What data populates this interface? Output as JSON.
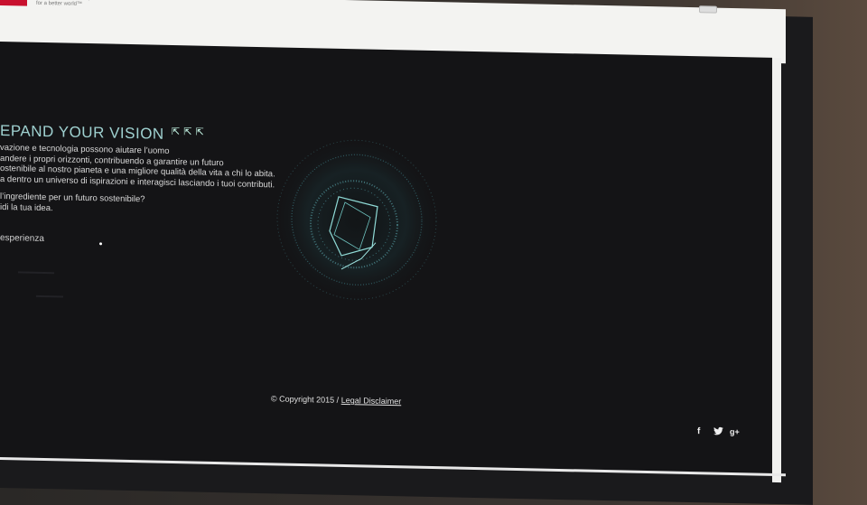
{
  "header": {
    "tagline": "Power and productivity\nfor a better world™"
  },
  "hero": {
    "title": "EPAND YOUR VISION",
    "paragraph1": "vazione e tecnologia possono aiutare l’uomo\nandere i propri orizzonti, contribuendo a garantire un futuro\nostenibile al nostro pianeta e una migliore qualità della vita a chi lo abita.\na dentro un universo di ispirazioni e interagisci lasciando i tuoi contributi.",
    "paragraph2": "l’ingrediente per un futuro sostenibile?\nidi la tua idea.",
    "experience_label": "esperienza"
  },
  "footer": {
    "copyright": "© Copyright 2015 / ",
    "legal_link": "Legal Disclaimer"
  },
  "social": {
    "facebook": "f",
    "twitter": "🐦",
    "googleplus": "g+"
  },
  "colors": {
    "accent": "#9fd1d0",
    "background": "#141416",
    "brand": "#c8102e"
  }
}
